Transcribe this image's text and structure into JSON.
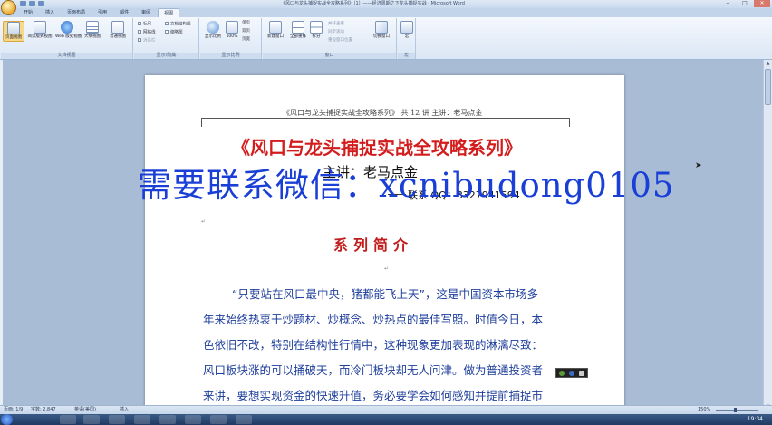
{
  "window": {
    "title": "《风口与龙头捕捉实战全攻略系列》（1）——经济周期之下龙头捕捉实战 - Microsoft Word",
    "controls": {
      "minimize": "–",
      "maximize": "□",
      "close": "✕"
    }
  },
  "tabs": [
    "开始",
    "插入",
    "页面布局",
    "引用",
    "邮件",
    "审阅",
    "视图"
  ],
  "active_tab": "视图",
  "ribbon": {
    "groups": {
      "views": {
        "label": "文档视图",
        "buttons": [
          "页面视图",
          "阅读版式视图",
          "Web 版式视图",
          "大纲视图",
          "普通视图"
        ]
      },
      "show": {
        "label": "显示/隐藏",
        "checks": [
          "标尺",
          "网格线",
          "消息栏",
          "文档结构图",
          "缩略图"
        ]
      },
      "zoom": {
        "label": "显示比例",
        "buttons": [
          "显示比例",
          "100%"
        ],
        "small": [
          "单页",
          "双页",
          "页宽"
        ]
      },
      "window": {
        "label": "窗口",
        "buttons": [
          "新建窗口",
          "全部重排",
          "拆分"
        ],
        "small": [
          "并排查看",
          "同步滚动",
          "重设窗口位置"
        ],
        "switch": "切换窗口"
      },
      "macro": {
        "label": "宏",
        "button": "宏"
      }
    }
  },
  "document": {
    "header": "《风口与龙头捕捉实战全攻略系列》  共 12 讲    主讲：老马点金",
    "title": "《风口与龙头捕捉实战全攻略系列》",
    "speaker": "主讲：老马点金",
    "contact": "联系 QQ：3327941594",
    "section_title": "系列简介",
    "paragraph_lines": [
      "“只要站在风口最中央，猪都能飞上天”，这是中国资本市场多",
      "年来始终热衷于炒题材、炒概念、炒热点的最佳写照。时值今日，本",
      "色依旧不改，特别在结构性行情中，这种现象更加表现的淋漓尽致：",
      "风口板块涨的可以捅破天，而冷门板块却无人问津。做为普通投资者",
      "来讲，要想实现资金的快速升值，务必要学会如何感知并提前捕捉市"
    ],
    "watermark": "需要联系微信：xcnibudong0105"
  },
  "status": {
    "page": "页面: 1/9",
    "words": "字数: 2,847",
    "language": "英语(美国)",
    "mode": "插入",
    "zoom": "150%"
  },
  "clock": "19:34",
  "colors": {
    "title_red": "#d31d1d",
    "body_blue": "#1f3f9c",
    "watermark_blue": "#1a3fd6",
    "ribbon_bg": "#dbe7f5"
  }
}
